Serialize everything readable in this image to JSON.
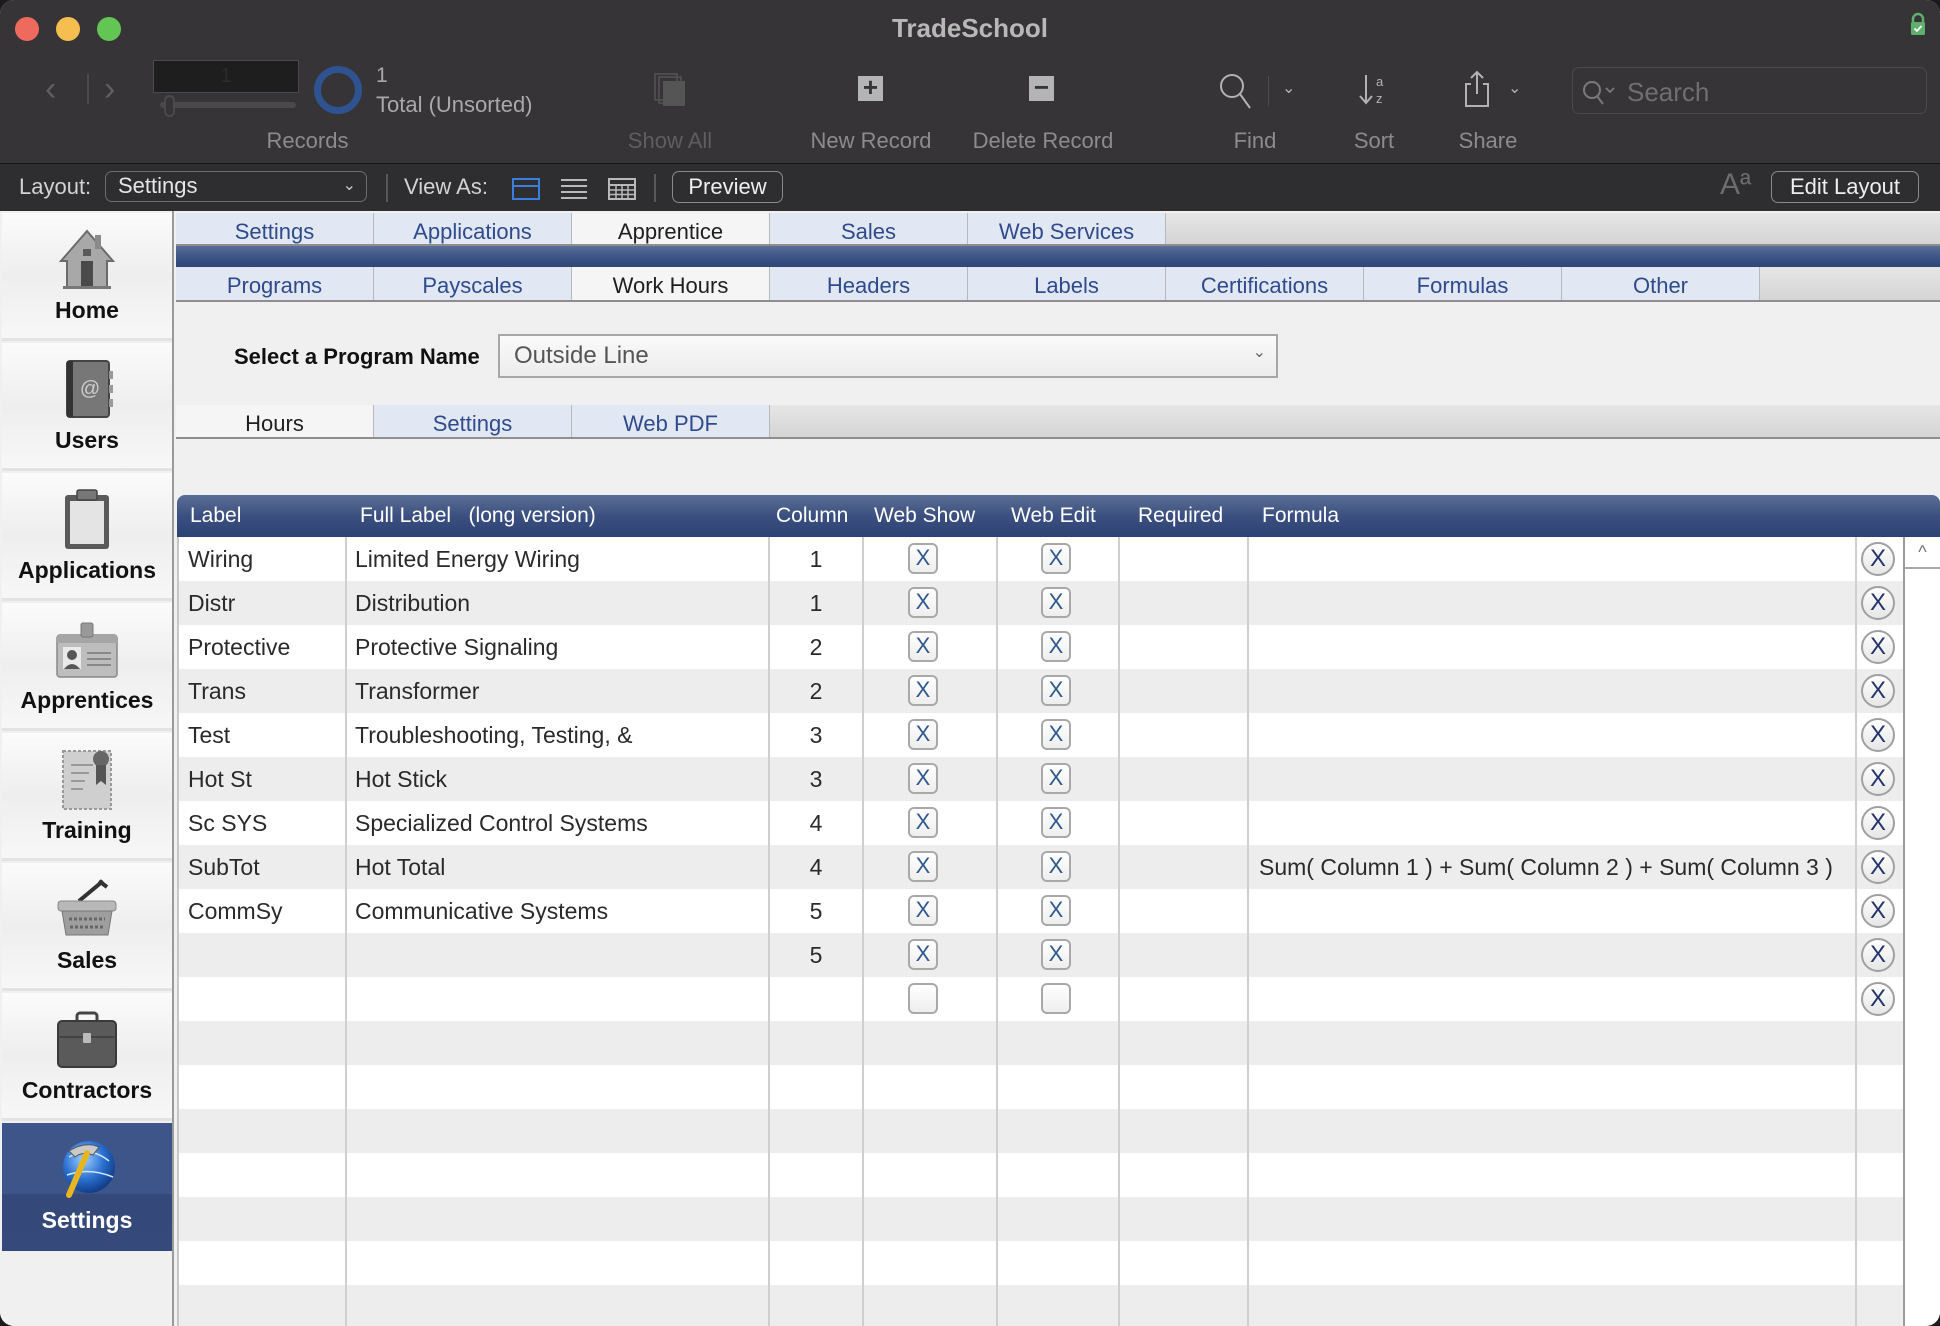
{
  "window": {
    "title": "TradeSchool"
  },
  "toolbar": {
    "records": {
      "current": "1",
      "count": "1",
      "total_label": "Total (Unsorted)",
      "label": "Records"
    },
    "show_all_label": "Show All",
    "new_record_label": "New Record",
    "delete_record_label": "Delete Record",
    "find_label": "Find",
    "sort_label": "Sort",
    "share_label": "Share",
    "search_placeholder": "Search"
  },
  "layout_bar": {
    "layout_label": "Layout:",
    "layout_value": "Settings",
    "view_as_label": "View As:",
    "preview_label": "Preview",
    "text_size_icon": "Aª",
    "edit_layout_label": "Edit Layout"
  },
  "sidebar": {
    "items": [
      {
        "label": "Home",
        "icon": "house-icon",
        "active": false
      },
      {
        "label": "Users",
        "icon": "address-book-icon",
        "active": false
      },
      {
        "label": "Applications",
        "icon": "clipboard-icon",
        "active": false
      },
      {
        "label": "Apprentices",
        "icon": "id-badge-icon",
        "active": false
      },
      {
        "label": "Training",
        "icon": "certificate-icon",
        "active": false
      },
      {
        "label": "Sales",
        "icon": "basket-icon",
        "active": false
      },
      {
        "label": "Contractors",
        "icon": "briefcase-icon",
        "active": false
      },
      {
        "label": "Settings",
        "icon": "hammer-globe-icon",
        "active": true
      }
    ]
  },
  "tabs_primary": [
    "Settings",
    "Applications",
    "Apprentice",
    "Sales",
    "Web Services"
  ],
  "tabs_primary_active": "Apprentice",
  "tabs_secondary": [
    "Programs",
    "Payscales",
    "Work Hours",
    "Headers",
    "Labels",
    "Certifications",
    "Formulas",
    "Other"
  ],
  "tabs_secondary_active": "Work Hours",
  "program": {
    "label": "Select a Program Name",
    "value": "Outside Line"
  },
  "tabs_tertiary": [
    "Hours",
    "Settings",
    "Web PDF"
  ],
  "tabs_tertiary_active": "Hours",
  "table": {
    "headers": {
      "label": "Label",
      "full_label": "Full Label   (long version)",
      "column": "Column",
      "web_show": "Web Show",
      "web_edit": "Web Edit",
      "required": "Required",
      "formula": "Formula"
    },
    "rows": [
      {
        "label": "Wiring",
        "full_label": "Limited Energy Wiring",
        "column": "1",
        "web_show": "X",
        "web_edit": "X",
        "required": "",
        "formula": ""
      },
      {
        "label": "Distr",
        "full_label": "Distribution",
        "column": "1",
        "web_show": "X",
        "web_edit": "X",
        "required": "",
        "formula": ""
      },
      {
        "label": "Protective",
        "full_label": "Protective Signaling",
        "column": "2",
        "web_show": "X",
        "web_edit": "X",
        "required": "",
        "formula": ""
      },
      {
        "label": "Trans",
        "full_label": "Transformer",
        "column": "2",
        "web_show": "X",
        "web_edit": "X",
        "required": "",
        "formula": ""
      },
      {
        "label": "Test",
        "full_label": "Troubleshooting, Testing, &",
        "column": "3",
        "web_show": "X",
        "web_edit": "X",
        "required": "",
        "formula": ""
      },
      {
        "label": "Hot St",
        "full_label": "Hot Stick",
        "column": "3",
        "web_show": "X",
        "web_edit": "X",
        "required": "",
        "formula": ""
      },
      {
        "label": "Sc SYS",
        "full_label": "Specialized Control Systems",
        "column": "4",
        "web_show": "X",
        "web_edit": "X",
        "required": "",
        "formula": ""
      },
      {
        "label": "SubTot",
        "full_label": "Hot Total",
        "column": "4",
        "web_show": "X",
        "web_edit": "X",
        "required": "",
        "formula": "Sum( Column 1 ) + Sum( Column 2 ) + Sum( Column 3 )"
      },
      {
        "label": "CommSy",
        "full_label": "Communicative Systems",
        "column": "5",
        "web_show": "X",
        "web_edit": "X",
        "required": "",
        "formula": ""
      },
      {
        "label": "",
        "full_label": "",
        "column": "5",
        "web_show": "X",
        "web_edit": "X",
        "required": "",
        "formula": ""
      },
      {
        "label": "",
        "full_label": "",
        "column": "",
        "web_show": "",
        "web_edit": "",
        "required": "",
        "formula": ""
      }
    ],
    "delete_glyph": "X",
    "empty_rows": 7
  }
}
